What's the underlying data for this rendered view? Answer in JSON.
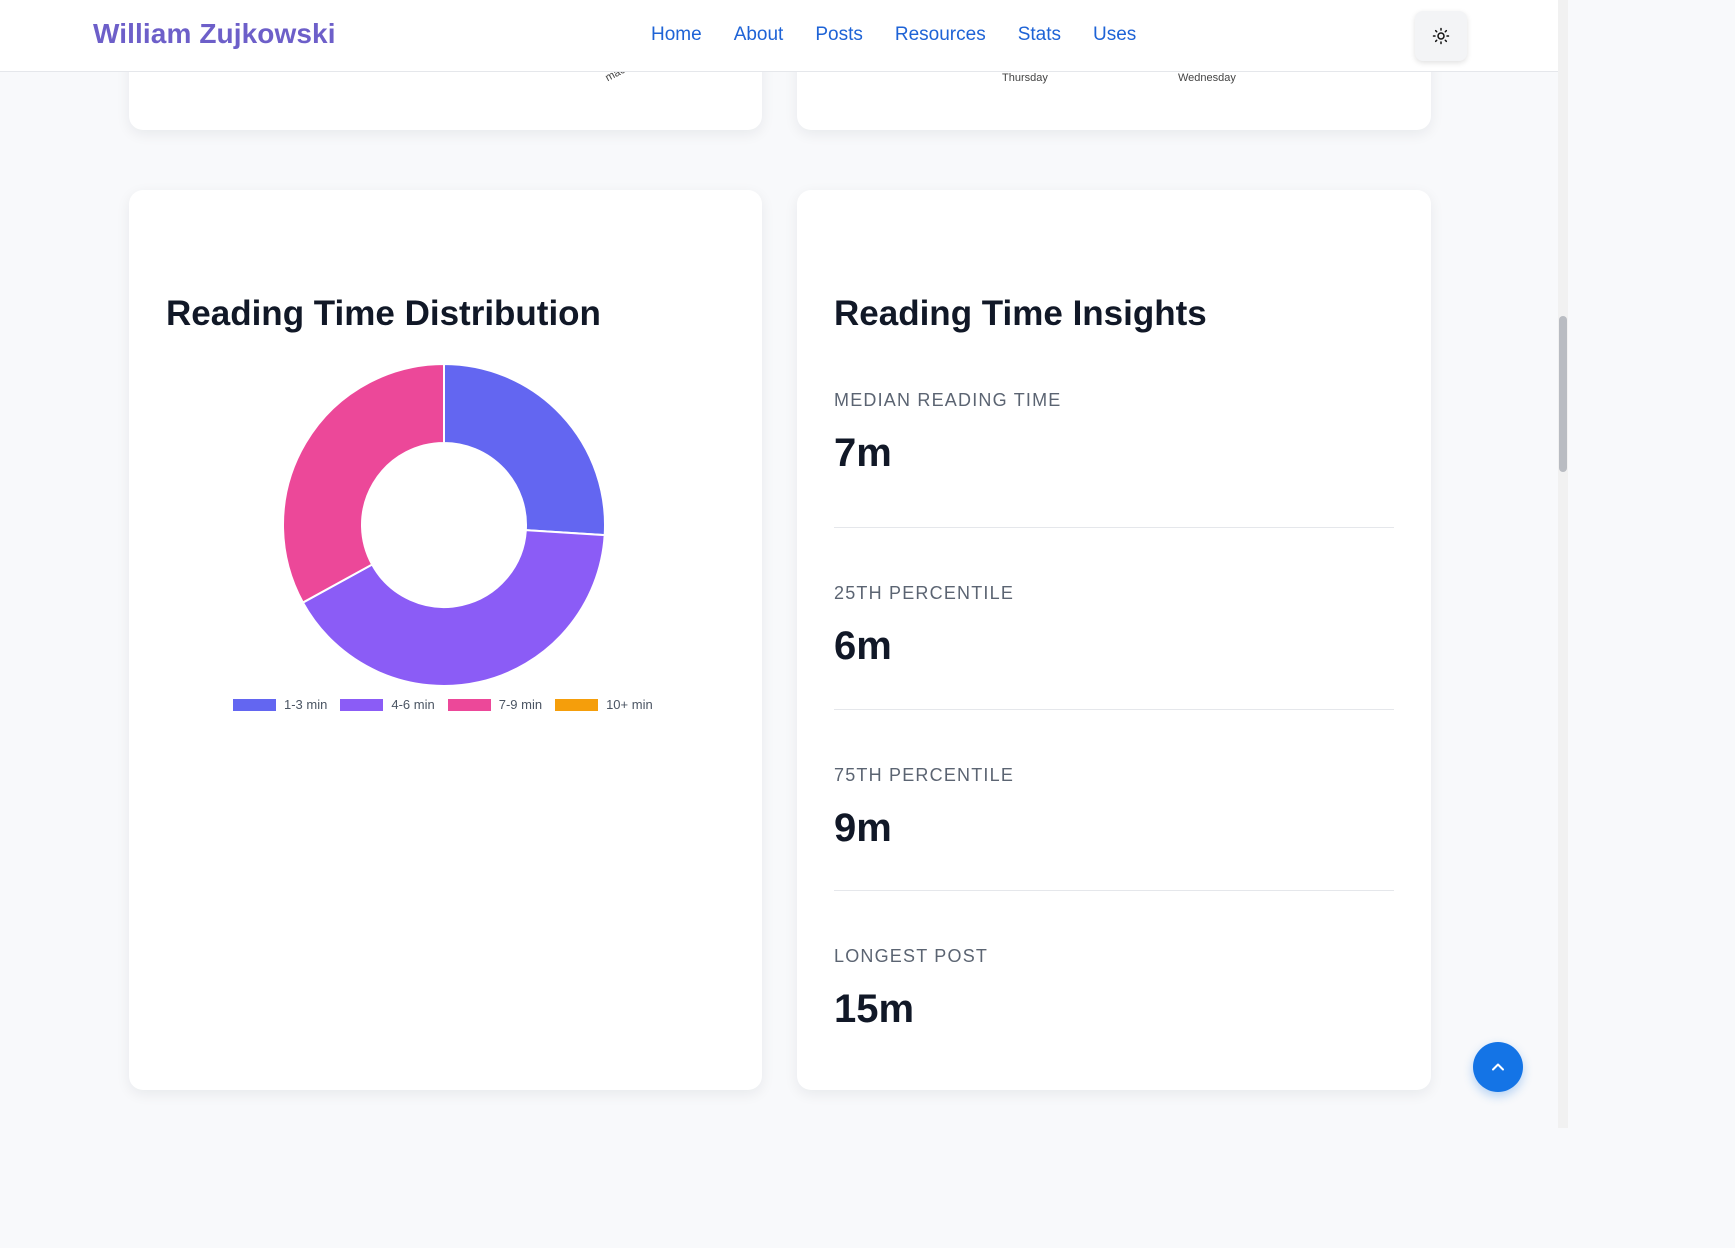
{
  "header": {
    "brand": "William Zujkowski",
    "nav": [
      "Home",
      "About",
      "Posts",
      "Resources",
      "Stats",
      "Uses"
    ]
  },
  "residual_cards": {
    "left_label": "mac",
    "right_labels": [
      "Thursday",
      "Wednesday"
    ]
  },
  "distribution_card": {
    "title": "Reading Time Distribution"
  },
  "chart_data": {
    "type": "pie",
    "categories": [
      "1-3 min",
      "4-6 min",
      "7-9 min",
      "10+ min"
    ],
    "values": [
      26,
      41,
      33,
      0
    ],
    "colors": [
      "#6366f1",
      "#8b5cf6",
      "#ec4899",
      "#f59e0b"
    ],
    "donut": true,
    "legend": "bottom"
  },
  "insights_card": {
    "title": "Reading Time Insights",
    "stats": [
      {
        "label": "Median Reading Time",
        "value": "7m"
      },
      {
        "label": "25th Percentile",
        "value": "6m"
      },
      {
        "label": "75th Percentile",
        "value": "9m"
      },
      {
        "label": "Longest Post",
        "value": "15m"
      }
    ]
  },
  "icons": {
    "theme_toggle": "sun-icon",
    "back_to_top": "chevron-up-icon"
  },
  "colors": {
    "brand": "#6d5fc9",
    "link": "#1e63d6",
    "accent": "#1474e6"
  }
}
